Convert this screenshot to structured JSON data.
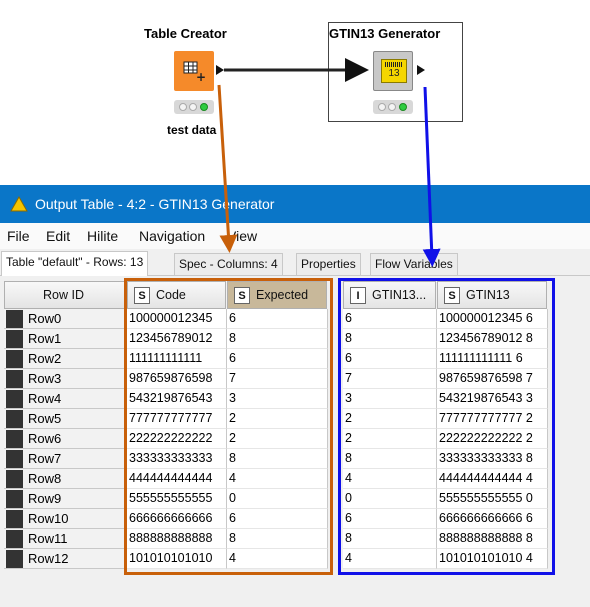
{
  "workflow": {
    "node1": {
      "title": "Table Creator",
      "label": "test data"
    },
    "node2": {
      "title": "GTIN13 Generator",
      "icon_text": "13"
    }
  },
  "window": {
    "title": "Output Table - 4:2 - GTIN13 Generator",
    "menu": [
      "File",
      "Edit",
      "Hilite",
      "Navigation",
      "View"
    ],
    "tabs": [
      "Table \"default\" - Rows: 13",
      "Spec - Columns: 4",
      "Properties",
      "Flow Variables"
    ]
  },
  "table": {
    "row_id_header": "Row ID",
    "columns": [
      {
        "type": "S",
        "name": "Code"
      },
      {
        "type": "S",
        "name": "Expected"
      },
      {
        "type": "I",
        "name": "GTIN13..."
      },
      {
        "type": "S",
        "name": "GTIN13"
      }
    ],
    "rows": [
      {
        "id": "Row0",
        "code": "100000012345",
        "expected": "6",
        "gtin_num": "6",
        "gtin": "100000012345 6"
      },
      {
        "id": "Row1",
        "code": "123456789012",
        "expected": "8",
        "gtin_num": "8",
        "gtin": "123456789012 8"
      },
      {
        "id": "Row2",
        "code": "111111111111",
        "expected": "6",
        "gtin_num": "6",
        "gtin": "111111111111 6"
      },
      {
        "id": "Row3",
        "code": "987659876598",
        "expected": "7",
        "gtin_num": "7",
        "gtin": "987659876598 7"
      },
      {
        "id": "Row4",
        "code": "543219876543",
        "expected": "3",
        "gtin_num": "3",
        "gtin": "543219876543 3"
      },
      {
        "id": "Row5",
        "code": "777777777777",
        "expected": "2",
        "gtin_num": "2",
        "gtin": "777777777777 2"
      },
      {
        "id": "Row6",
        "code": "222222222222",
        "expected": "2",
        "gtin_num": "2",
        "gtin": "222222222222 2"
      },
      {
        "id": "Row7",
        "code": "333333333333",
        "expected": "8",
        "gtin_num": "8",
        "gtin": "333333333333 8"
      },
      {
        "id": "Row8",
        "code": "444444444444",
        "expected": "4",
        "gtin_num": "4",
        "gtin": "444444444444 4"
      },
      {
        "id": "Row9",
        "code": "555555555555",
        "expected": "0",
        "gtin_num": "0",
        "gtin": "555555555555 0"
      },
      {
        "id": "Row10",
        "code": "666666666666",
        "expected": "6",
        "gtin_num": "6",
        "gtin": "666666666666 6"
      },
      {
        "id": "Row11",
        "code": "888888888888",
        "expected": "8",
        "gtin_num": "8",
        "gtin": "888888888888 8"
      },
      {
        "id": "Row12",
        "code": "101010101010",
        "expected": "4",
        "gtin_num": "4",
        "gtin": "101010101010 4"
      }
    ]
  },
  "colors": {
    "titlebar": "#0a76c8",
    "node1_orange": "#f58a2a",
    "node2_yellow": "#f5d600",
    "highlight_orange": "#c8600a",
    "highlight_blue": "#1010e8",
    "sorted_header": "#c8b89a"
  }
}
